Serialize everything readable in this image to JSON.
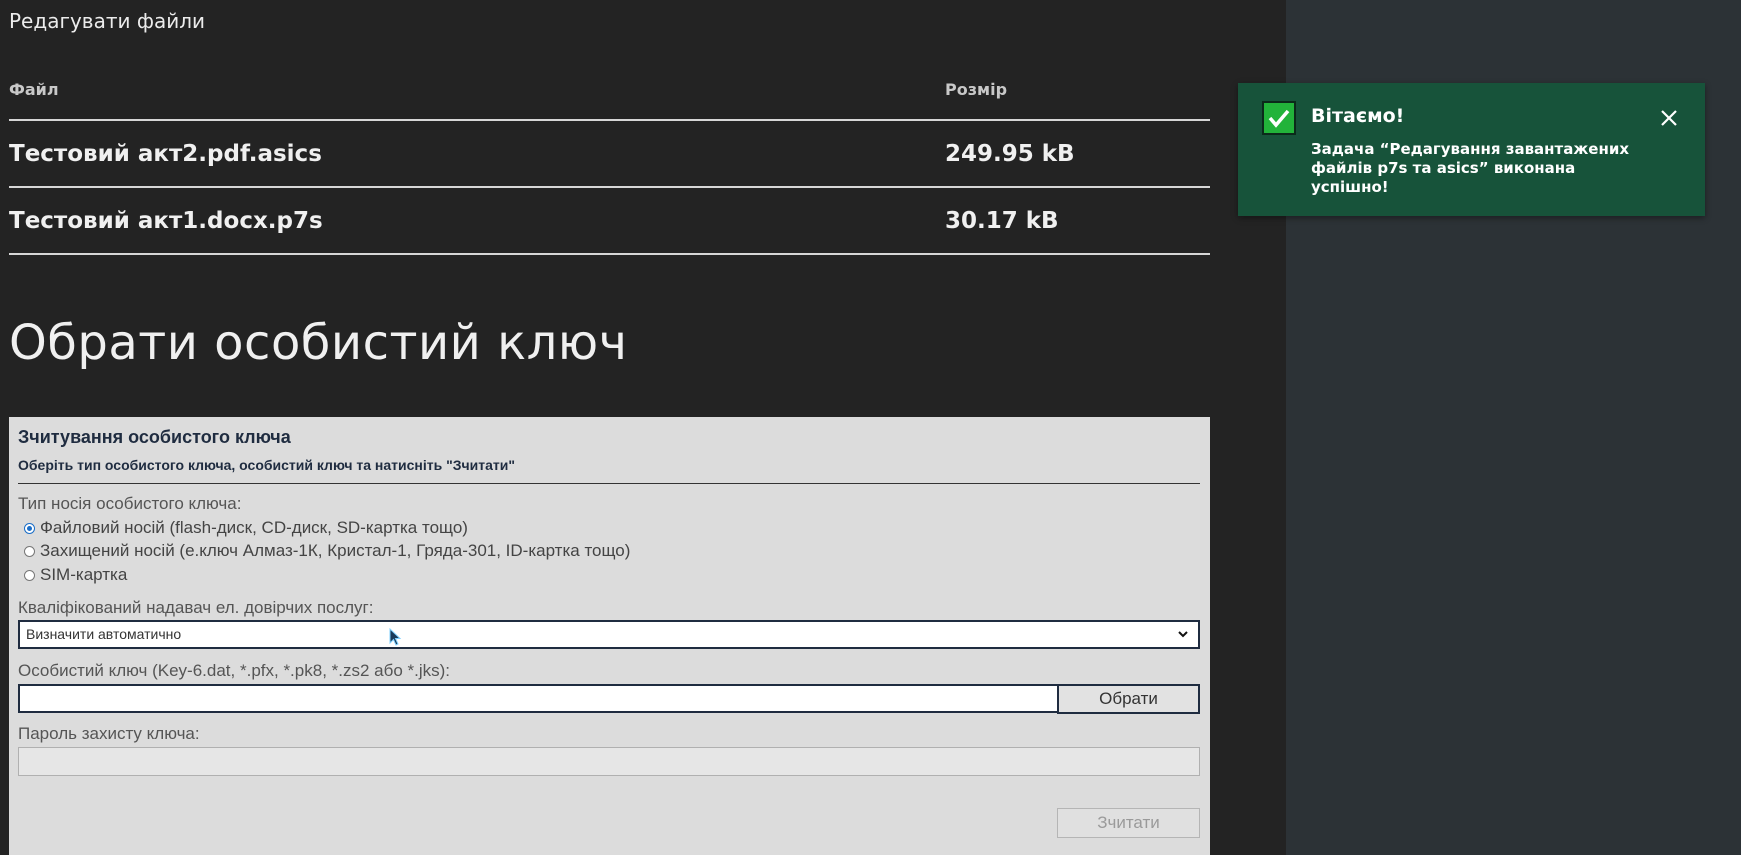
{
  "page": {
    "heading": "Редагувати файли"
  },
  "files_table": {
    "headers": {
      "name": "Файл",
      "size": "Розмір"
    },
    "rows": [
      {
        "name": "Тестовий акт2.pdf.asics",
        "size": "249.95 kB"
      },
      {
        "name": "Тестовий акт1.docx.p7s",
        "size": "30.17 kB"
      }
    ]
  },
  "key_section": {
    "title": "Обрати особистий ключ"
  },
  "key_widget": {
    "title": "Зчитування особистого ключа",
    "subtitle": "Оберіть тип особистого ключа, особистий ключ та натисніть \"Зчитати\"",
    "media_type_label": "Тип носія особистого ключа:",
    "media_options": [
      {
        "label": "Файловий носій (flash-диск, CD-диск, SD-картка тощо)",
        "checked": true
      },
      {
        "label": "Захищений носій (е.ключ Алмаз-1К, Кристал-1, Гряда-301, ID-картка тощо)",
        "checked": false
      },
      {
        "label": "SIM-картка",
        "checked": false
      }
    ],
    "provider_label": "Кваліфікований надавач ел. довірчих послуг:",
    "provider_selected": "Визначити автоматично",
    "key_file_label": "Особистий ключ (Key-6.dat, *.pfx, *.pk8, *.zs2 або *.jks):",
    "key_file_value": "",
    "choose_button": "Обрати",
    "password_label": "Пароль захисту ключа:",
    "password_value": "",
    "read_button": "Зчитати"
  },
  "toast": {
    "title": "Вітаємо!",
    "message": "Задача “Редагування завантажених файлів p7s та asics” виконана успішно!",
    "icons": {
      "status": "check-icon",
      "close": "close-icon"
    },
    "colors": {
      "background": "#17533a",
      "check": "#22b33a"
    }
  }
}
